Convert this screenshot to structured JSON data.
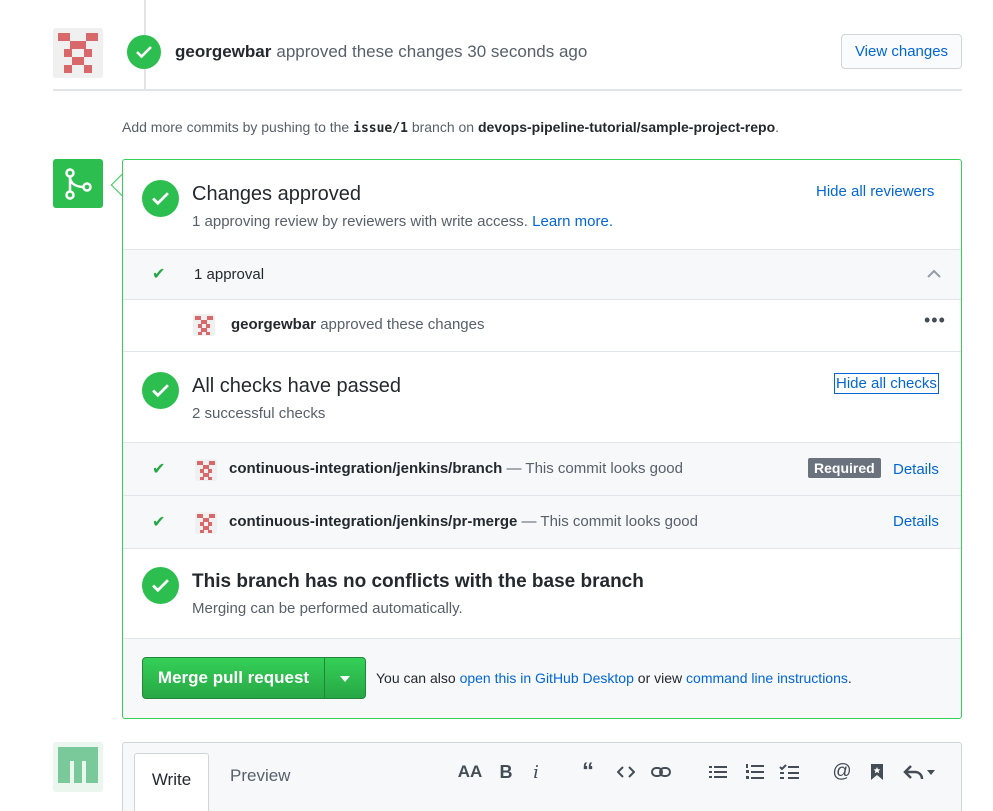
{
  "review": {
    "user": "georgewbar",
    "text": "approved these changes 30 seconds ago",
    "view_changes": "View changes"
  },
  "push_note": {
    "prefix": "Add more commits by pushing to the",
    "branch": "issue/1",
    "middle": "branch on",
    "repo": "devops-pipeline-tutorial/sample-project-repo",
    "suffix": "."
  },
  "approved": {
    "title": "Changes approved",
    "subtitle": "1 approving review by reviewers with write access.",
    "learn_more": "Learn more.",
    "hide": "Hide all reviewers",
    "approval_count": "1 approval",
    "reviewer": "georgewbar",
    "reviewer_text": "approved these changes"
  },
  "checks": {
    "title": "All checks have passed",
    "subtitle": "2 successful checks",
    "hide": "Hide all checks",
    "items": [
      {
        "name": "continuous-integration/jenkins/branch",
        "desc": "— This commit looks good",
        "badge": "Required",
        "details": "Details"
      },
      {
        "name": "continuous-integration/jenkins/pr-merge",
        "desc": "— This commit looks good",
        "details": "Details"
      }
    ]
  },
  "conflicts": {
    "title": "This branch has no conflicts with the base branch",
    "subtitle": "Merging can be performed automatically."
  },
  "merge": {
    "button": "Merge pull request",
    "also_prefix": "You can also",
    "desktop_link": "open this in GitHub Desktop",
    "or_view": "or view",
    "cli_link": "command line instructions",
    "suffix": "."
  },
  "composer": {
    "tab_write": "Write",
    "tab_preview": "Preview",
    "tools": [
      "heading-icon",
      "bold-icon",
      "italic-icon",
      "quote-icon",
      "code-icon",
      "link-icon",
      "unordered-list-icon",
      "ordered-list-icon",
      "task-list-icon",
      "mention-icon",
      "saved-reply-icon",
      "reply-icon"
    ]
  },
  "colors": {
    "green": "#2cbe4e",
    "link": "#0366d6",
    "border_green": "#34d058"
  }
}
